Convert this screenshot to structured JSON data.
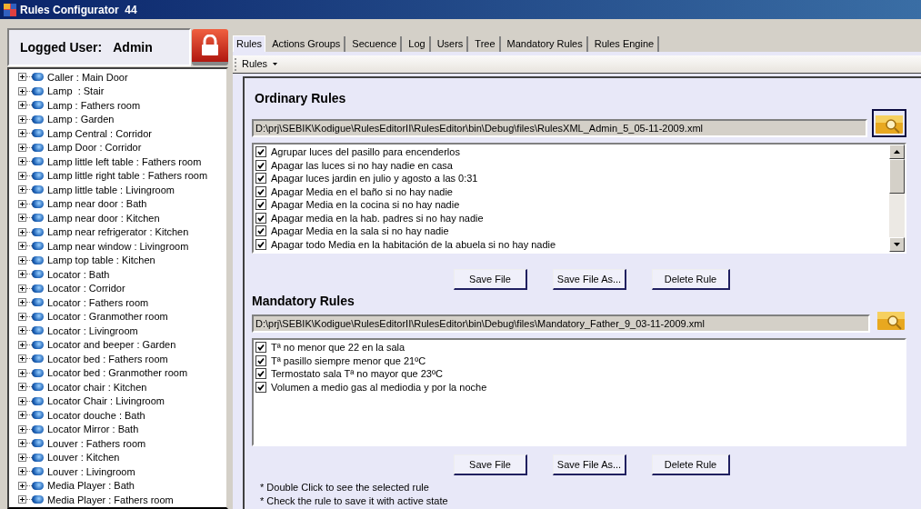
{
  "window": {
    "title": "Rules Configurator  44"
  },
  "user_panel": {
    "label": "Logged User:",
    "user": "Admin"
  },
  "tree": {
    "items": [
      {
        "label": "Caller : Main Door",
        "expanded": false
      },
      {
        "label": "Lamp  : Stair",
        "expanded": false
      },
      {
        "label": "Lamp : Fathers room",
        "expanded": false
      },
      {
        "label": "Lamp : Garden",
        "expanded": false
      },
      {
        "label": "Lamp Central : Corridor",
        "expanded": false
      },
      {
        "label": "Lamp Door : Corridor",
        "expanded": false
      },
      {
        "label": "Lamp little left table : Fathers room",
        "expanded": false
      },
      {
        "label": "Lamp little right table : Fathers room",
        "expanded": false
      },
      {
        "label": "Lamp little table : Livingroom",
        "expanded": false
      },
      {
        "label": "Lamp near door : Bath",
        "expanded": false
      },
      {
        "label": "Lamp near door : Kitchen",
        "expanded": false
      },
      {
        "label": "Lamp near refrigerator : Kitchen",
        "expanded": false
      },
      {
        "label": "Lamp near window : Livingroom",
        "expanded": false
      },
      {
        "label": "Lamp top table : Kitchen",
        "expanded": false
      },
      {
        "label": "Locator : Bath",
        "expanded": false
      },
      {
        "label": "Locator : Corridor",
        "expanded": false
      },
      {
        "label": "Locator : Fathers room",
        "expanded": false
      },
      {
        "label": "Locator : Granmother room",
        "expanded": false
      },
      {
        "label": "Locator : Livingroom",
        "expanded": false
      },
      {
        "label": "Locator and beeper : Garden",
        "expanded": false
      },
      {
        "label": "Locator bed : Fathers room",
        "expanded": false
      },
      {
        "label": "Locator bed : Granmother room",
        "expanded": false
      },
      {
        "label": "Locator chair : Kitchen",
        "expanded": false
      },
      {
        "label": "Locator Chair : Livingroom",
        "expanded": false
      },
      {
        "label": "Locator douche : Bath",
        "expanded": false
      },
      {
        "label": "Locator Mirror : Bath",
        "expanded": false
      },
      {
        "label": "Louver : Fathers room",
        "expanded": false
      },
      {
        "label": "Louver : Kitchen",
        "expanded": false
      },
      {
        "label": "Louver : Livingroom",
        "expanded": false
      },
      {
        "label": "Media Player : Bath",
        "expanded": false
      },
      {
        "label": "Media Player : Fathers room",
        "expanded": false
      }
    ]
  },
  "tabs": [
    {
      "label": "Rules",
      "selected": true
    },
    {
      "label": "Actions Groups",
      "selected": false
    },
    {
      "label": "Secuence",
      "selected": false
    },
    {
      "label": "Log",
      "selected": false
    },
    {
      "label": "Users",
      "selected": false
    },
    {
      "label": "Tree",
      "selected": false
    },
    {
      "label": "Mandatory Rules",
      "selected": false
    },
    {
      "label": "Rules Engine",
      "selected": false
    }
  ],
  "toolbar": {
    "menu": "Rules"
  },
  "sections": [
    {
      "title": "Ordinary Rules",
      "path": "D:\\prj\\SEBIK\\Kodigue\\RulesEditorII\\RulesEditor\\bin\\Debug\\files\\RulesXML_Admin_5_05-11-2009.xml",
      "scrollable": true,
      "rules": [
        {
          "label": "Agrupar luces del pasillo para encenderlos",
          "checked": true
        },
        {
          "label": "Apagar las luces si no hay nadie en casa",
          "checked": true
        },
        {
          "label": "Apagar luces jardin en julio y agosto a las 0:31",
          "checked": true
        },
        {
          "label": "Apagar Media en el baño si no hay nadie",
          "checked": true
        },
        {
          "label": "Apagar Media en la cocina si no hay nadie",
          "checked": true
        },
        {
          "label": "Apagar media en la hab. padres si no hay nadie",
          "checked": true
        },
        {
          "label": "Apagar Media en la sala si no hay nadie",
          "checked": true
        },
        {
          "label": "Apagar todo Media en la habitación de la abuela si no hay nadie",
          "checked": true
        }
      ],
      "buttons": [
        "Save File",
        "Save File As...",
        "Delete Rule"
      ]
    },
    {
      "title": "Mandatory Rules",
      "path": "D:\\prj\\SEBIK\\Kodigue\\RulesEditorII\\RulesEditor\\bin\\Debug\\files\\Mandatory_Father_9_03-11-2009.xml",
      "scrollable": false,
      "rules": [
        {
          "label": "Tª no menor que 22 en la sala",
          "checked": true
        },
        {
          "label": "Tª pasillo siempre menor que 21ºC",
          "checked": true
        },
        {
          "label": "Termostato sala Tª no mayor que 23ºC",
          "checked": true
        },
        {
          "label": "Volumen a medio gas al mediodia y por la noche",
          "checked": true
        }
      ],
      "buttons": [
        "Save File",
        "Save File As...",
        "Delete Rule"
      ]
    }
  ],
  "notes": [
    "* Double Click to see the selected rule",
    "* Check the rule to save it with active state"
  ]
}
